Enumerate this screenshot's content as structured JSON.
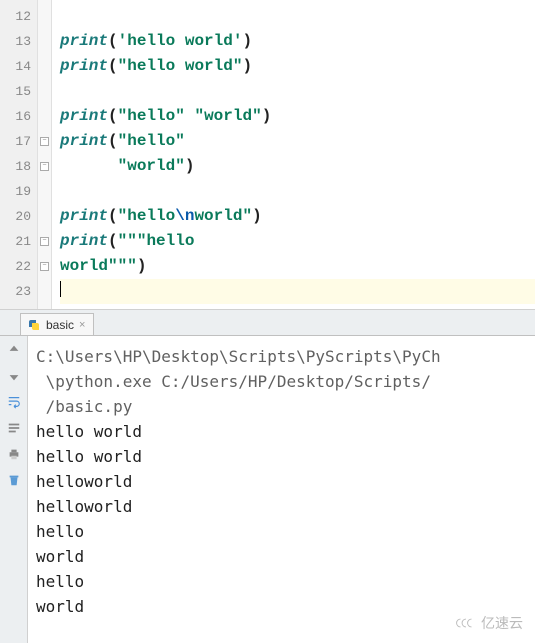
{
  "editor": {
    "lines": [
      {
        "num": "12",
        "segs": []
      },
      {
        "num": "13",
        "segs": [
          {
            "t": "func",
            "v": "print"
          },
          {
            "t": "paren",
            "v": "("
          },
          {
            "t": "quote",
            "v": "'"
          },
          {
            "t": "str",
            "v": "hello world"
          },
          {
            "t": "quote",
            "v": "'"
          },
          {
            "t": "paren",
            "v": ")"
          }
        ]
      },
      {
        "num": "14",
        "segs": [
          {
            "t": "func",
            "v": "print"
          },
          {
            "t": "paren",
            "v": "("
          },
          {
            "t": "quote",
            "v": "\""
          },
          {
            "t": "str",
            "v": "hello world"
          },
          {
            "t": "quote",
            "v": "\""
          },
          {
            "t": "paren",
            "v": ")"
          }
        ]
      },
      {
        "num": "15",
        "segs": []
      },
      {
        "num": "16",
        "segs": [
          {
            "t": "func",
            "v": "print"
          },
          {
            "t": "paren",
            "v": "("
          },
          {
            "t": "quote",
            "v": "\""
          },
          {
            "t": "str",
            "v": "hello"
          },
          {
            "t": "quote",
            "v": "\""
          },
          {
            "t": "plain",
            "v": " "
          },
          {
            "t": "quote",
            "v": "\""
          },
          {
            "t": "str",
            "v": "world"
          },
          {
            "t": "quote",
            "v": "\""
          },
          {
            "t": "paren",
            "v": ")"
          }
        ]
      },
      {
        "num": "17",
        "fold": true,
        "segs": [
          {
            "t": "func",
            "v": "print"
          },
          {
            "t": "paren",
            "v": "("
          },
          {
            "t": "quote",
            "v": "\""
          },
          {
            "t": "str",
            "v": "hello"
          },
          {
            "t": "quote",
            "v": "\""
          }
        ]
      },
      {
        "num": "18",
        "foldEnd": true,
        "indent": 6,
        "segs": [
          {
            "t": "quote",
            "v": "\""
          },
          {
            "t": "str",
            "v": "world"
          },
          {
            "t": "quote",
            "v": "\""
          },
          {
            "t": "paren",
            "v": ")"
          }
        ]
      },
      {
        "num": "19",
        "segs": []
      },
      {
        "num": "20",
        "segs": [
          {
            "t": "func",
            "v": "print"
          },
          {
            "t": "paren",
            "v": "("
          },
          {
            "t": "quote",
            "v": "\""
          },
          {
            "t": "str",
            "v": "hello"
          },
          {
            "t": "esc",
            "v": "\\n"
          },
          {
            "t": "str",
            "v": "world"
          },
          {
            "t": "quote",
            "v": "\""
          },
          {
            "t": "paren",
            "v": ")"
          }
        ]
      },
      {
        "num": "21",
        "fold": true,
        "segs": [
          {
            "t": "func",
            "v": "print"
          },
          {
            "t": "paren",
            "v": "("
          },
          {
            "t": "quote",
            "v": "\"\"\""
          },
          {
            "t": "str",
            "v": "hello"
          }
        ]
      },
      {
        "num": "22",
        "foldEnd": true,
        "noIndent": true,
        "segs": [
          {
            "t": "str",
            "v": "world"
          },
          {
            "t": "quote",
            "v": "\"\"\""
          },
          {
            "t": "paren",
            "v": ")"
          }
        ]
      },
      {
        "num": "23",
        "current": true,
        "segs": [
          {
            "t": "cursor",
            "v": ""
          }
        ]
      }
    ]
  },
  "run": {
    "tab_label": "basic",
    "command_lines": [
      "C:\\Users\\HP\\Desktop\\Scripts\\PyScripts\\PyCh",
      " \\python.exe C:/Users/HP/Desktop/Scripts/",
      " /basic.py"
    ],
    "output": [
      "hello world",
      "hello world",
      "helloworld",
      "helloworld",
      "hello",
      "world",
      "hello",
      "world"
    ]
  },
  "watermark": "亿速云"
}
